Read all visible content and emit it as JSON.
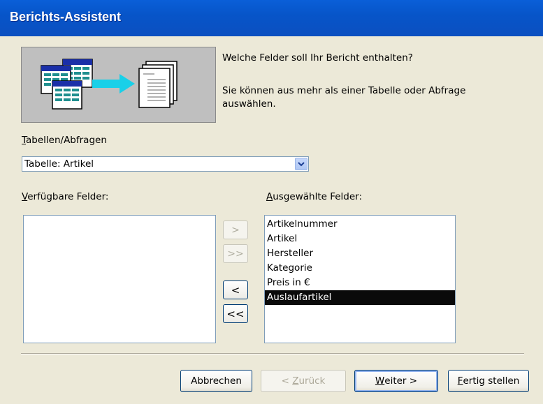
{
  "window": {
    "title": "Berichts-Assistent"
  },
  "header": {
    "question": "Welche Felder soll Ihr Bericht enthalten?",
    "hint": "Sie können aus mehr als einer Tabelle oder Abfrage auswählen."
  },
  "source": {
    "label_underlined": "T",
    "label_rest": "abellen/Abfragen",
    "selected": "Tabelle: Artikel"
  },
  "available": {
    "label_underlined": "V",
    "label_rest": "erfügbare Felder:",
    "items": []
  },
  "selected_fields": {
    "label_underlined": "A",
    "label_rest": "usgewählte Felder:",
    "items": [
      "Artikelnummer",
      "Artikel",
      "Hersteller",
      "Kategorie",
      "Preis in €",
      "Auslaufartikel"
    ],
    "highlighted": "Auslaufartikel"
  },
  "move_buttons": {
    "add": ">",
    "add_all": ">>",
    "remove": "<",
    "remove_all": "<<"
  },
  "footer": {
    "cancel": "Abbrechen",
    "back_prefix": "< ",
    "back_underlined": "Z",
    "back_rest": "urück",
    "next_underlined": "W",
    "next_rest": "eiter >",
    "finish_underlined": "F",
    "finish_rest": "ertig stellen"
  }
}
